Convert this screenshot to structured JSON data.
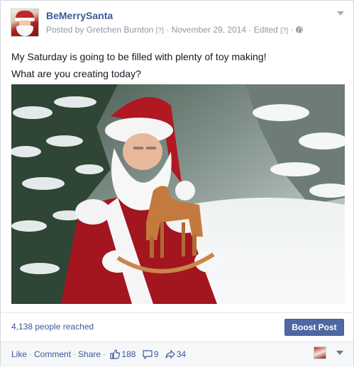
{
  "post": {
    "page_name": "BeMerrySanta",
    "posted_by": "Posted by Gretchen Burnton",
    "help_marker": "[?]",
    "date": "November 29, 2014",
    "edited": "Edited",
    "dot": "·",
    "text_line1": "My Saturday is going to be filled with plenty of toy making!",
    "text_line2": "What are you creating today?",
    "photo_icon": "santa-with-rocking-horse-photo"
  },
  "reach": {
    "people_reached": "4,138 people reached",
    "boost_label": "Boost Post"
  },
  "actions": {
    "like": "Like",
    "comment": "Comment",
    "share": "Share",
    "separator": "·",
    "likes_count": "188",
    "comments_count": "9",
    "shares_count": "34"
  },
  "colors": {
    "link_blue": "#3b5998",
    "boost_blue": "#4e69a2",
    "meta_gray": "#9197a3"
  }
}
